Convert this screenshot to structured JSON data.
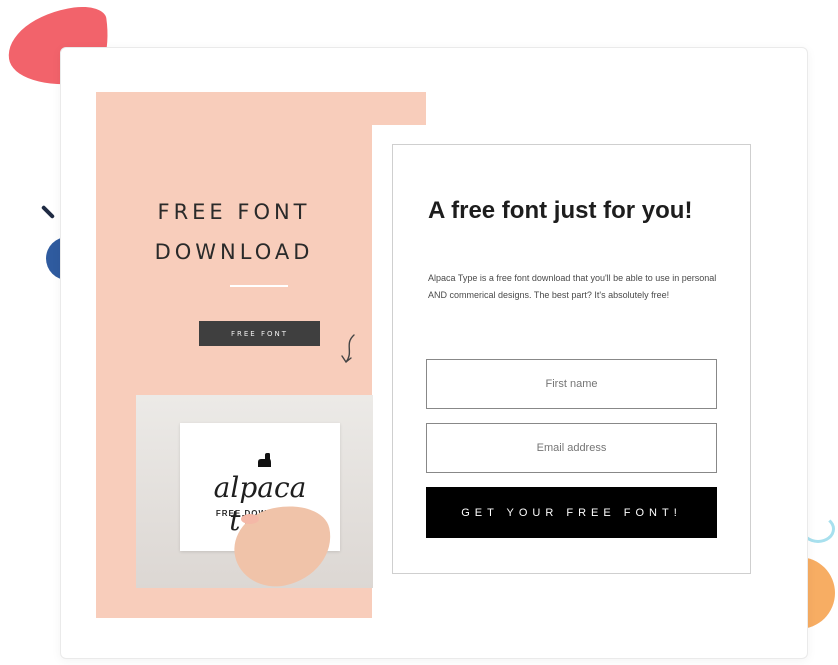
{
  "hero": {
    "title_line1": "FREE FONT",
    "title_line2": "DOWNLOAD",
    "pill": "FREE FONT"
  },
  "photo": {
    "brand": "alpaca type",
    "subline": "FREE DOWNLOAD!"
  },
  "form": {
    "title": "A free font just for you!",
    "body": "Alpaca Type is a free font download that you'll be able to use in personal AND commerical designs. The best part? It's absolutely free!",
    "first_name_placeholder": "First name",
    "email_placeholder": "Email address",
    "submit_label": "GET YOUR FREE FONT!"
  },
  "colors": {
    "accent_pink": "#f8cdbb",
    "button_dark": "#000000",
    "deco_red": "#f2636b",
    "deco_blue": "#2f5b9f",
    "deco_orange": "#f7ad63"
  },
  "icons": {
    "arrow": "curved-arrow-icon",
    "alpaca": "alpaca-icon"
  }
}
